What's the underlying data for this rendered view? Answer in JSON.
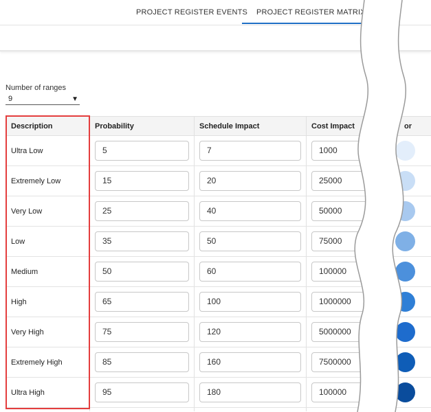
{
  "tabs": [
    {
      "label": "PROJECT REGISTER EVENTS",
      "active": false
    },
    {
      "label": "PROJECT REGISTER MATRIX",
      "active": true
    }
  ],
  "ranges": {
    "label": "Number of ranges",
    "value": "9"
  },
  "table": {
    "headers": {
      "description": "Description",
      "probability": "Probability",
      "schedule": "Schedule Impact",
      "cost": "Cost Impact",
      "color": "or"
    },
    "rows": [
      {
        "description": "Ultra Low",
        "probability": "5",
        "schedule": "7",
        "cost": "1000",
        "color": "#e3eefb"
      },
      {
        "description": "Extremely Low",
        "probability": "15",
        "schedule": "20",
        "cost": "25000",
        "color": "#c9def6"
      },
      {
        "description": "Very Low",
        "probability": "25",
        "schedule": "40",
        "cost": "50000",
        "color": "#a8c9ef"
      },
      {
        "description": "Low",
        "probability": "35",
        "schedule": "50",
        "cost": "75000",
        "color": "#7fb0e6"
      },
      {
        "description": "Medium",
        "probability": "50",
        "schedule": "60",
        "cost": "100000",
        "color": "#4c90dc"
      },
      {
        "description": "High",
        "probability": "65",
        "schedule": "100",
        "cost": "1000000",
        "color": "#2f7fd6"
      },
      {
        "description": "Very High",
        "probability": "75",
        "schedule": "120",
        "cost": "5000000",
        "color": "#1e6ccd"
      },
      {
        "description": "Extremely High",
        "probability": "85",
        "schedule": "160",
        "cost": "7500000",
        "color": "#0f5db7"
      },
      {
        "description": "Ultra High",
        "probability": "95",
        "schedule": "180",
        "cost": "100000",
        "color": "#0a4c9c"
      }
    ]
  },
  "colors": {
    "accent": "#1f6fc5",
    "highlight": "#e43d3d"
  }
}
